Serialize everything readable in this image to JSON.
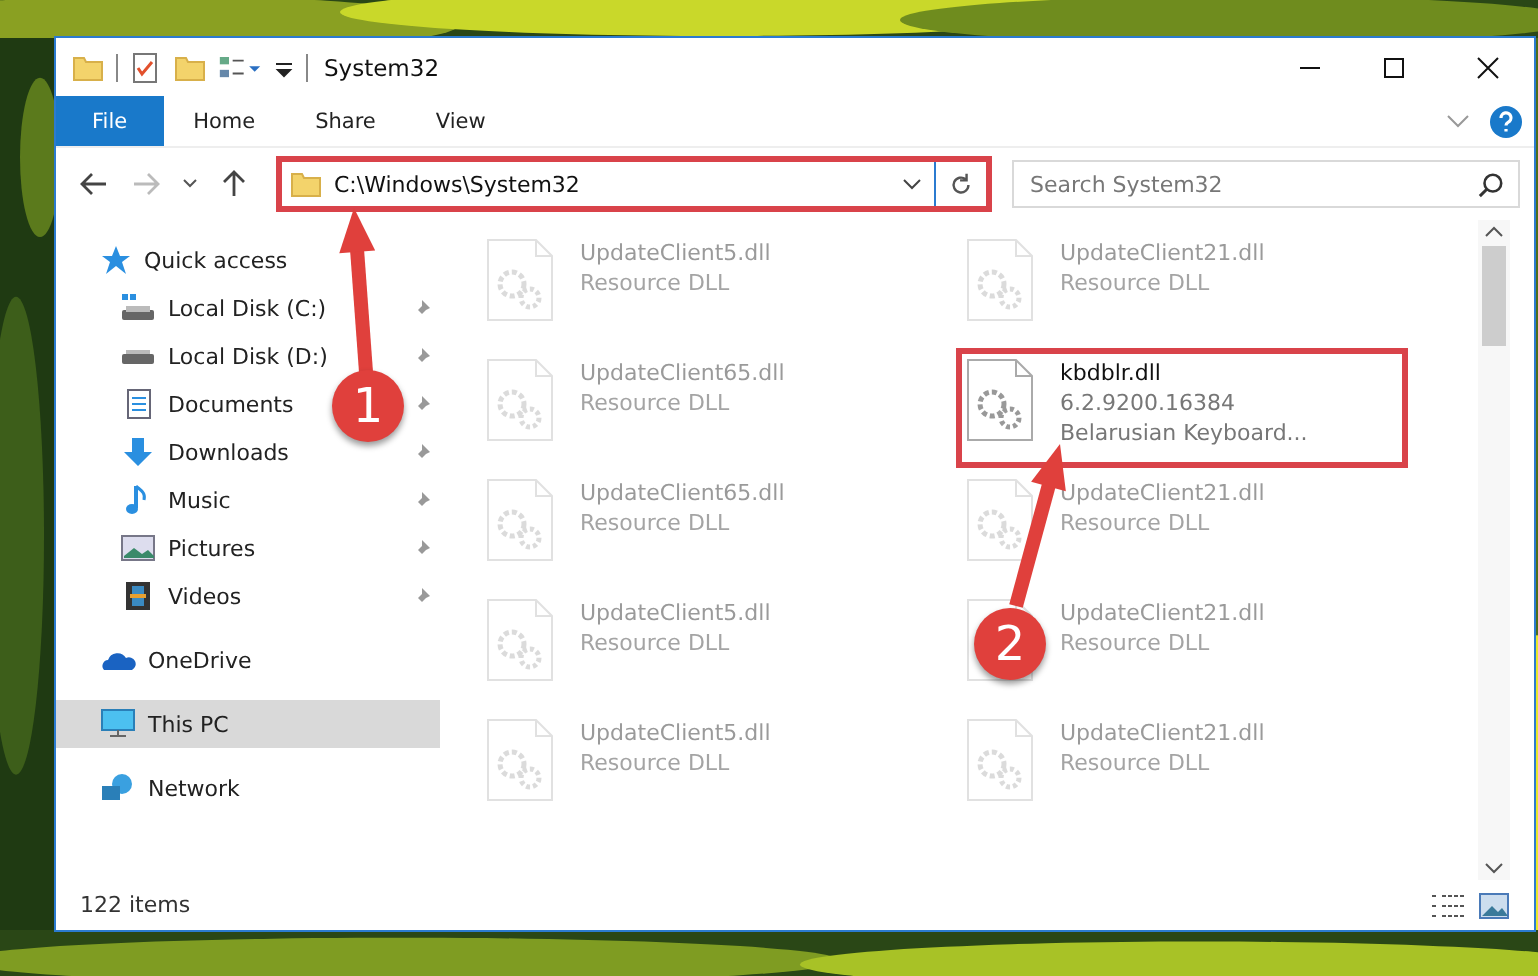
{
  "window": {
    "title": "System32"
  },
  "ribbon_tabs": [
    {
      "label": "File",
      "selected": true
    },
    {
      "label": "Home",
      "selected": false
    },
    {
      "label": "Share",
      "selected": false
    },
    {
      "label": "View",
      "selected": false
    }
  ],
  "address": {
    "path": "C:\\Windows\\System32",
    "highlighted": true
  },
  "search": {
    "placeholder": "Search System32"
  },
  "sidebar": [
    {
      "label": "Quick access",
      "kind": "star",
      "selected": false,
      "children": [
        {
          "label": "Local Disk (C:)",
          "kind": "sysdrive",
          "pinned": true,
          "selected": false
        },
        {
          "label": "Local Disk (D:)",
          "kind": "drive",
          "pinned": true,
          "selected": false
        },
        {
          "label": "Documents",
          "kind": "docs",
          "pinned": true,
          "selected": false
        },
        {
          "label": "Downloads",
          "kind": "down",
          "pinned": true,
          "selected": false
        },
        {
          "label": "Music",
          "kind": "music",
          "pinned": true,
          "selected": false
        },
        {
          "label": "Pictures",
          "kind": "pics",
          "pinned": true,
          "selected": false
        },
        {
          "label": "Videos",
          "kind": "video",
          "pinned": true,
          "selected": false
        }
      ]
    },
    {
      "label": "OneDrive",
      "kind": "cloud",
      "selected": false
    },
    {
      "label": "This PC",
      "kind": "pc",
      "selected": true
    },
    {
      "label": "Network",
      "kind": "net",
      "selected": false
    }
  ],
  "files": [
    {
      "name": "UpdateClient5.dll",
      "description": "Resource DLL",
      "faded": true,
      "highlighted": false
    },
    {
      "name": "UpdateClient21.dll",
      "description": "Resource DLL",
      "faded": true,
      "highlighted": false
    },
    {
      "name": "UpdateClient65.dll",
      "description": "Resource DLL",
      "faded": true,
      "highlighted": false
    },
    {
      "name": "kbdblr.dll",
      "version": "6.2.9200.16384",
      "description": "Belarusian Keyboard...",
      "faded": false,
      "highlighted": true
    },
    {
      "name": "UpdateClient65.dll",
      "description": "Resource DLL",
      "faded": true,
      "highlighted": false
    },
    {
      "name": "UpdateClient21.dll",
      "description": "Resource DLL",
      "faded": true,
      "highlighted": false
    },
    {
      "name": "UpdateClient5.dll",
      "description": "Resource DLL",
      "faded": true,
      "highlighted": false
    },
    {
      "name": "UpdateClient21.dll",
      "description": "Resource DLL",
      "faded": true,
      "highlighted": false
    },
    {
      "name": "UpdateClient5.dll",
      "description": "Resource DLL",
      "faded": true,
      "highlighted": false
    },
    {
      "name": "UpdateClient21.dll",
      "description": "Resource DLL",
      "faded": true,
      "highlighted": false
    }
  ],
  "annotations": [
    {
      "number": "1"
    },
    {
      "number": "2"
    }
  ],
  "status_bar": {
    "item_count": "122 items"
  }
}
